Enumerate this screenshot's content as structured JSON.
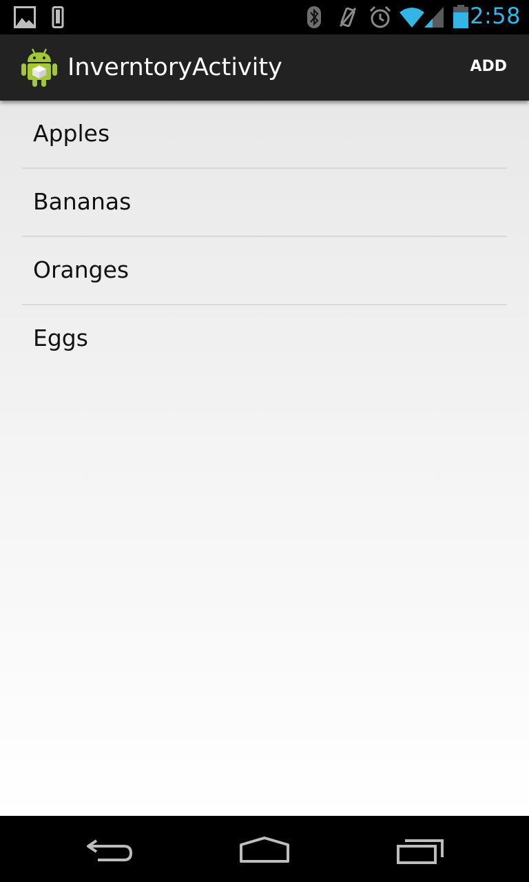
{
  "status_bar": {
    "time": "2:58",
    "accent_color": "#33b5e5",
    "left_icons": [
      "gallery-icon",
      "phone-icon"
    ],
    "right_icons": [
      "bluetooth-icon",
      "vibrate-off-icon",
      "alarm-icon",
      "wifi-icon",
      "signal-icon",
      "battery-icon"
    ]
  },
  "action_bar": {
    "app_icon": "android-app-icon",
    "title": "InverntoryActivity",
    "add_label": "ADD"
  },
  "list": {
    "items": [
      {
        "label": "Apples"
      },
      {
        "label": "Bananas"
      },
      {
        "label": "Oranges"
      },
      {
        "label": "Eggs"
      }
    ]
  },
  "nav_bar": {
    "icons": [
      "back-icon",
      "home-icon",
      "recents-icon"
    ]
  }
}
